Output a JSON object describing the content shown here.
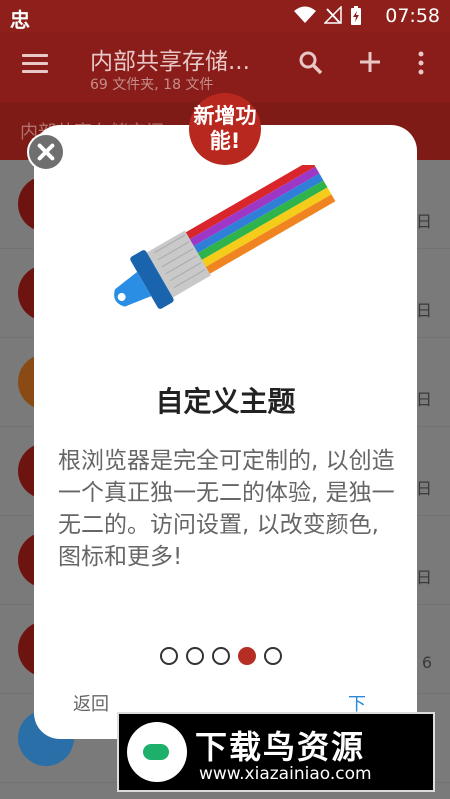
{
  "statusbar": {
    "time": "07:58",
    "app_glyph": "忠"
  },
  "appbar": {
    "title": "内部共享存储...",
    "subtitle": "69 文件夹, 18 文件"
  },
  "pathbar": {
    "text": "内部共享存储空间"
  },
  "list": {
    "tail_char": "日",
    "tail_char_alt": "6"
  },
  "badge": {
    "text": "新增功\n能!"
  },
  "dialog": {
    "title": "自定义主题",
    "body": "根浏览器是完全可定制的, 以创造一个真正独一无二的体验, 是独一无二的。访问设置, 以改变颜色, 图标和更多!",
    "back_label": "返回",
    "next_label": "下",
    "pager": {
      "total": 5,
      "active": 4
    }
  },
  "watermark": {
    "title": "下载鸟资源",
    "url": "www.xiazainiao.com"
  },
  "colors": {
    "accent": "#b52e24",
    "next_link": "#2d89d6",
    "appbar": "#8a1d19"
  }
}
